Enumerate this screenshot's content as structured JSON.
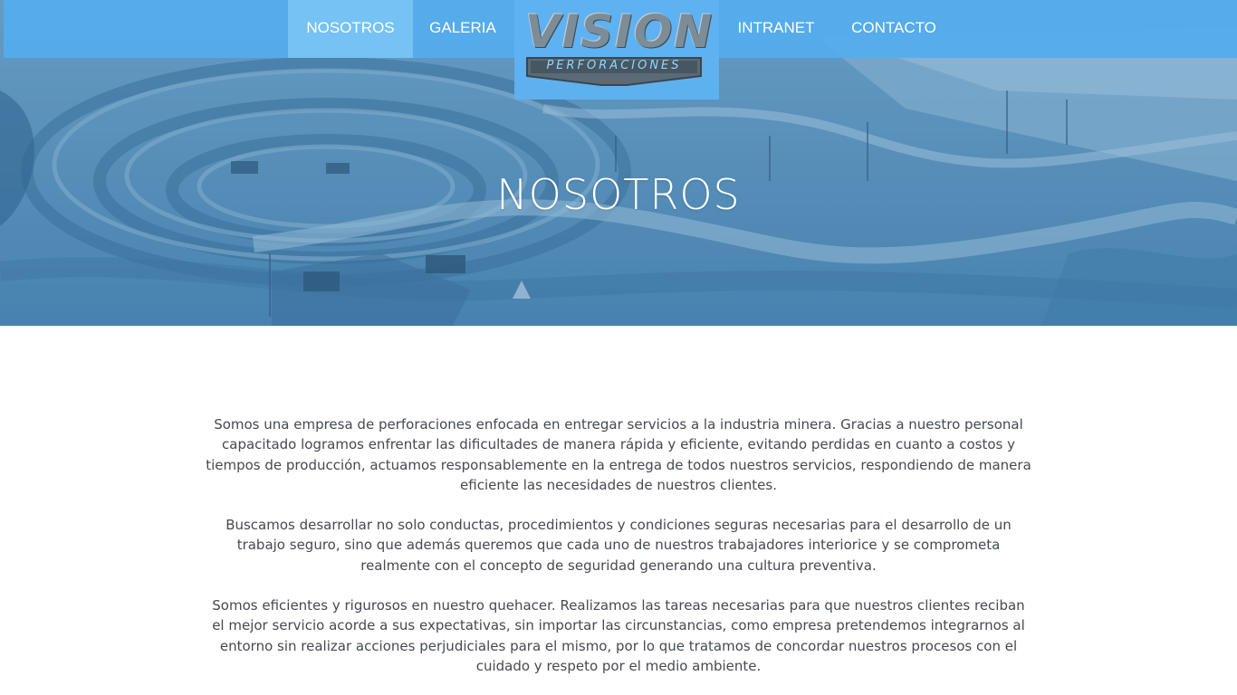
{
  "nav": {
    "items": [
      {
        "label": "NOSOTROS",
        "active": true
      },
      {
        "label": "GALERIA",
        "active": false
      },
      {
        "label": "INTRANET",
        "active": false
      },
      {
        "label": "CONTACTO",
        "active": false
      }
    ],
    "logo": {
      "word": "VISION",
      "sub": "PERFORACIONES"
    },
    "colors": {
      "bar": "#55acee",
      "active": "#78c3f5"
    }
  },
  "hero": {
    "title": "NOSOTROS",
    "background": "open-pit mine photograph (blue tint)"
  },
  "content": {
    "paragraphs": [
      "Somos una empresa de perforaciones enfocada en entregar servicios a la industria minera. Gracias a nuestro personal capacitado logramos enfrentar las dificultades de manera rápida y eficiente, evitando perdidas en cuanto a costos y tiempos de producción, actuamos responsablemente en la entrega de todos nuestros servicios, respondiendo de manera eficiente las necesidades de nuestros clientes.",
      "Buscamos desarrollar no solo conductas, procedimientos y condiciones seguras necesarias para el desarrollo de un trabajo seguro, sino que además queremos que cada uno de nuestros trabajadores interiorice y se comprometa realmente con el concepto de seguridad generando una cultura preventiva.",
      "Somos eficientes y rigurosos en nuestro quehacer. Realizamos las tareas necesarias para que nuestros clientes reciban el mejor servicio acorde a sus expectativas, sin importar las circunstancias, como empresa pretendemos integrarnos al entorno sin realizar acciones perjudiciales para el mismo, por lo que tratamos de concordar nuestros procesos con el cuidado y respeto por el medio ambiente."
    ]
  }
}
